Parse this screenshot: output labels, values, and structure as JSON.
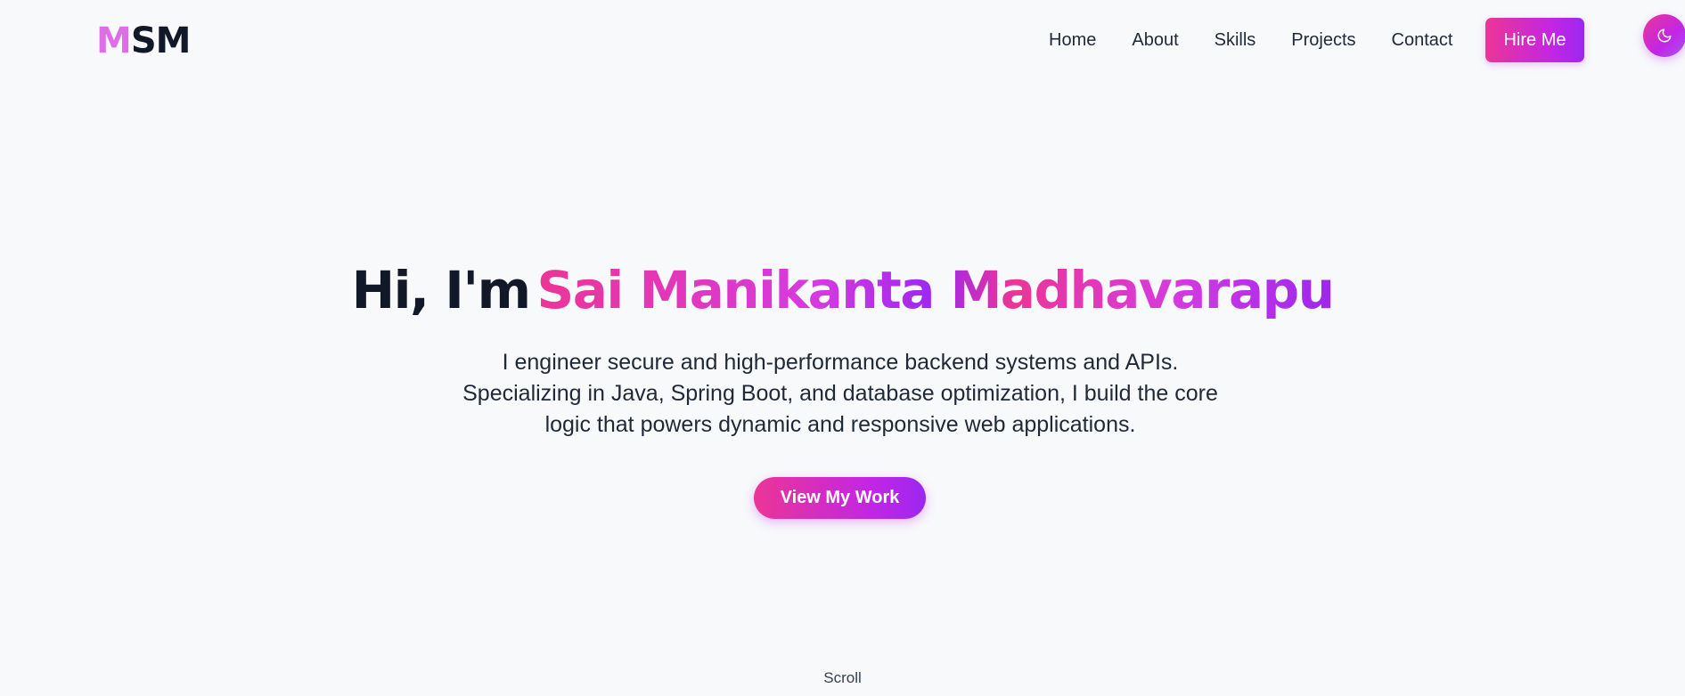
{
  "header": {
    "logo": {
      "first_letter": "M",
      "rest": "SM"
    },
    "nav": [
      {
        "label": "Home"
      },
      {
        "label": "About"
      },
      {
        "label": "Skills"
      },
      {
        "label": "Projects"
      },
      {
        "label": "Contact"
      }
    ],
    "hire_label": "Hire Me",
    "theme_toggle_icon": "moon-icon"
  },
  "hero": {
    "greeting": "Hi, I'm",
    "name": "Sai Manikanta Madhavarapu",
    "description": "I engineer secure and high-performance backend systems and APIs. Specializing in Java, Spring Boot, and database optimization, I build the core logic that powers dynamic and responsive web applications.",
    "cta_label": "View My Work"
  },
  "scroll_label": "Scroll",
  "colors": {
    "background": "#f8f9fb",
    "accent_pink": "#ec3596",
    "accent_purple": "#9d27ef",
    "logo_pink": "#dd6ee6",
    "text_dark": "#111827"
  }
}
